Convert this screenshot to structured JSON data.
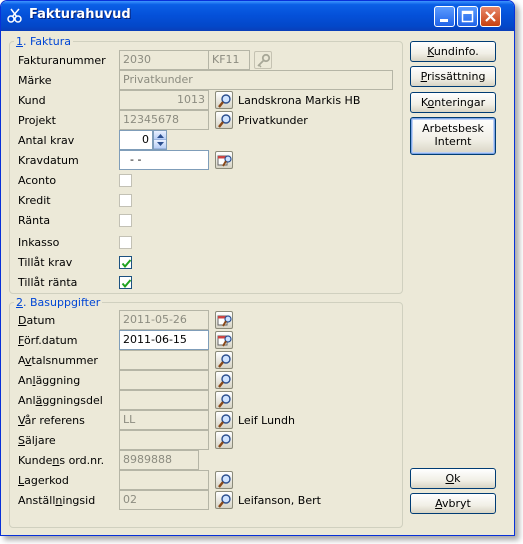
{
  "window": {
    "title": "Fakturahuvud",
    "app_icon": "scissors-icon",
    "controls": [
      "minimize-icon",
      "maximize-icon",
      "close-icon"
    ]
  },
  "faktura": {
    "legend_mnemonic": "1",
    "legend_rest": ". Faktura",
    "fakturanummer": {
      "label": "Fakturanummer",
      "value": "2030",
      "series": "KF11"
    },
    "marke": {
      "label": "Märke",
      "value": "Privatkunder"
    },
    "kund": {
      "label": "Kund",
      "value": "1013",
      "name": "Landskrona Markis HB"
    },
    "projekt": {
      "label": "Projekt",
      "value": "12345678",
      "name": "Privatkunder"
    },
    "antal_krav": {
      "label": "Antal krav",
      "value": "0"
    },
    "kravdatum": {
      "label": "Kravdatum",
      "value": "- -"
    },
    "aconto": {
      "label": "Aconto",
      "checked": false
    },
    "kredit": {
      "label": "Kredit",
      "checked": false
    },
    "ranta": {
      "label": "Ränta",
      "checked": false
    },
    "inkasso": {
      "label": "Inkasso",
      "checked": false
    },
    "tillat_krav": {
      "label": "Tillåt krav",
      "checked": true
    },
    "tillat_ranta": {
      "label": "Tillåt ränta",
      "checked": true
    }
  },
  "basuppgifter": {
    "legend_mnemonic": "2",
    "legend_rest": ". Basuppgifter",
    "datum": {
      "label_u": "D",
      "label_rest": "atum",
      "value": "2011-05-26"
    },
    "forf_datum": {
      "label_u": "F",
      "label_rest": "örf.datum",
      "value": "2011-06-15"
    },
    "avtalsnummer": {
      "label_pre": "A",
      "label_u": "v",
      "label_rest": "talsnummer",
      "value": ""
    },
    "anlaggning": {
      "label_pre": "An",
      "label_u": "l",
      "label_rest": "äggning",
      "value": ""
    },
    "anlaggningsdel": {
      "label_pre": "Anl",
      "label_u": "ä",
      "label_rest": "ggningsdel",
      "value": ""
    },
    "var_referens": {
      "label_u": "V",
      "label_rest": "år referens",
      "value": "LL",
      "name": "Leif Lundh"
    },
    "saljare": {
      "label_u": "S",
      "label_rest": "äljare",
      "value": ""
    },
    "kundens_ordnr": {
      "label_pre": "Kunde",
      "label_u": "n",
      "label_rest": "s ord.nr.",
      "value": "8989888"
    },
    "lagerkod": {
      "label_u": "L",
      "label_rest": "agerkod",
      "value": ""
    },
    "anstallningsid": {
      "label_pre": "Anställ",
      "label_u": "n",
      "label_rest": "ingsid",
      "value": "02",
      "name": "Leifanson, Bert"
    }
  },
  "buttons": {
    "kundinfo": {
      "label_u": "K",
      "label_rest": "undinfo."
    },
    "prissattning": {
      "label_u": "P",
      "label_rest": "rissättning"
    },
    "konteringar": {
      "label_pre": "K",
      "label_u": "o",
      "label_rest": "nteringar"
    },
    "arbetsbesk": {
      "line1": "Arbetsbesk",
      "line2": "Internt"
    },
    "ok": {
      "label_u": "O",
      "label_rest": "k"
    },
    "avbryt": {
      "label_u": "A",
      "label_rest": "vbryt"
    }
  },
  "icons": {
    "lookup": "magnifier-icon",
    "calendar_lookup": "calendar-magnifier-icon",
    "key": "key-icon",
    "checkmark": "checkmark-icon"
  },
  "colors": {
    "titlebar": "#0450d8",
    "legend": "#0046d5",
    "face": "#ece9d8",
    "checkmark": "#21a121"
  }
}
